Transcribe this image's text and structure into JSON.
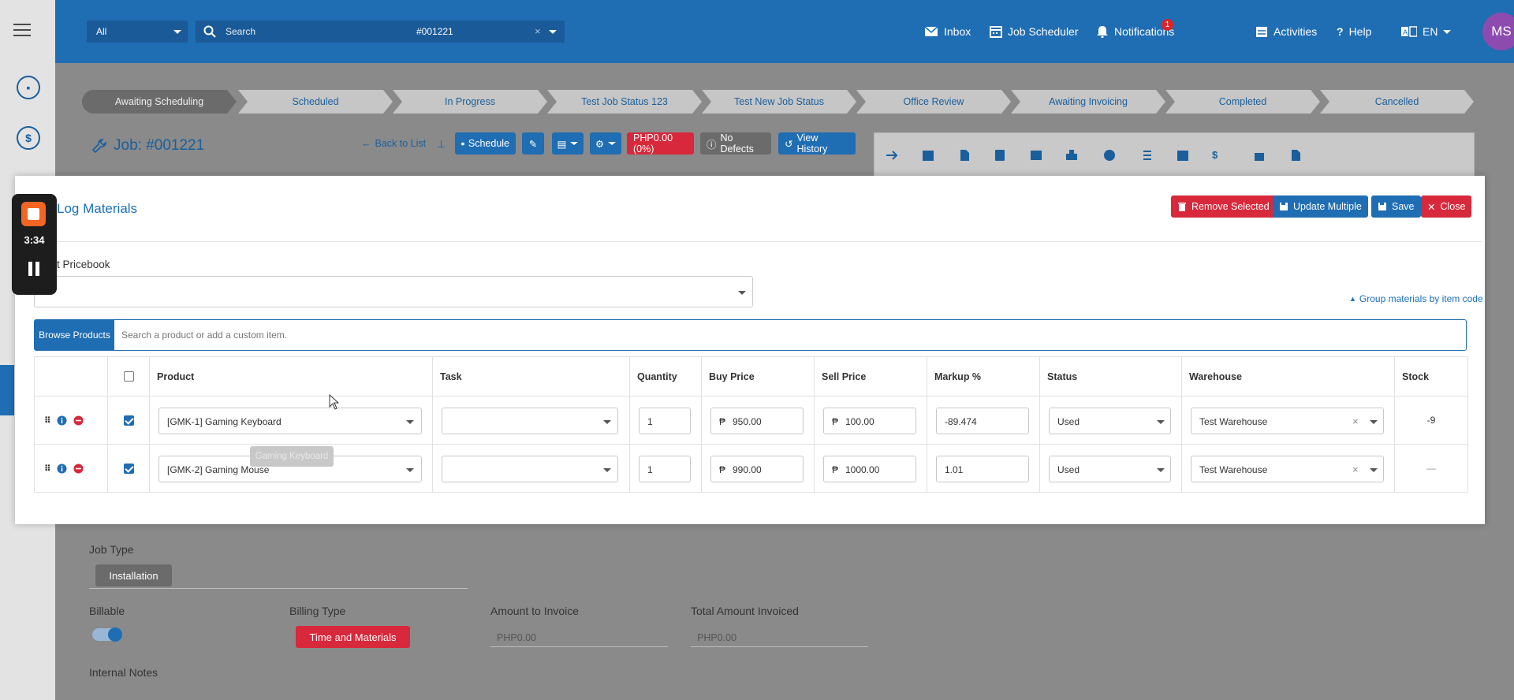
{
  "topbar": {
    "filter_value": "All",
    "search_placeholder": "Search",
    "job_select_value": "#001221",
    "nav": {
      "inbox": "Inbox",
      "job_scheduler": "Job Scheduler",
      "notifications": "Notifications",
      "notifications_count": "1",
      "activities": "Activities",
      "help": "Help",
      "language": "EN"
    },
    "avatar_initials": "MS"
  },
  "pipeline": [
    "Awaiting Scheduling",
    "Scheduled",
    "In Progress",
    "Test Job Status 123",
    "Test New Job Status",
    "Office Review",
    "Awaiting Invoicing",
    "Completed",
    "Cancelled"
  ],
  "job_header": {
    "title": "Job: #001221",
    "back_to_list": "Back to List",
    "schedule": "Schedule",
    "amount_badge": "PHP0.00 (0%)",
    "defects_badge": "No Defects",
    "view_history": "View History"
  },
  "recorder": {
    "time": "3:34"
  },
  "modal": {
    "title": "Log Materials",
    "remove_selected": "Remove Selected",
    "update_multiple": "Update Multiple",
    "save": "Save",
    "close": "Close",
    "pricebook_label": "t Pricebook",
    "group_link": "Group materials by item code",
    "browse_button": "Browse Products",
    "search_placeholder": "Search a product or add a custom item.",
    "columns": [
      "",
      "",
      "Product",
      "Task",
      "Quantity",
      "Buy Price",
      "Sell Price",
      "Markup %",
      "Status",
      "Warehouse",
      "Stock"
    ],
    "currency_symbol": "₱",
    "rows": [
      {
        "product": "[GMK-1] Gaming Keyboard",
        "task": "",
        "quantity": "1",
        "buy_price": "950.00",
        "sell_price": "100.00",
        "markup": "-89.474",
        "status": "Used",
        "warehouse": "Test Warehouse",
        "stock": "-9",
        "checked": true
      },
      {
        "product": "[GMK-2] Gaming Mouse",
        "task": "",
        "quantity": "1",
        "buy_price": "990.00",
        "sell_price": "1000.00",
        "markup": "1.01",
        "status": "Used",
        "warehouse": "Test Warehouse",
        "stock": "—",
        "checked": true
      }
    ],
    "tooltip": "Gaming Keyboard"
  },
  "form": {
    "job_type_label": "Job Type",
    "job_type_value": "Installation",
    "billable_label": "Billable",
    "billing_type_label": "Billing Type",
    "billing_type_value": "Time and Materials",
    "amount_to_invoice_label": "Amount to Invoice",
    "amount_to_invoice_value": "PHP0.00",
    "total_invoiced_label": "Total Amount Invoiced",
    "total_invoiced_value": "PHP0.00",
    "internal_notes_label": "Internal Notes"
  },
  "colors": {
    "primary": "#1f6db3",
    "danger": "#d8283b",
    "avatar": "#8d4bb0",
    "recorder_stop": "#f26522"
  }
}
